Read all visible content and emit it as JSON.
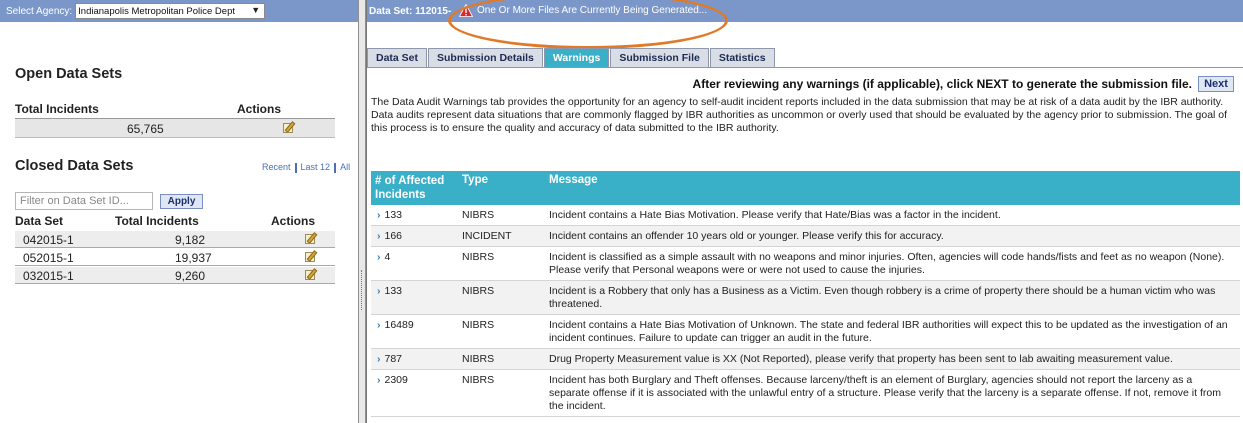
{
  "left": {
    "agency_label": "Select Agency:",
    "agency_value": "Indianapolis Metropolitan Police Dept",
    "open": {
      "title": "Open Data Sets",
      "col_total": "Total Incidents",
      "col_actions": "Actions",
      "total": "65,765"
    },
    "closed": {
      "title": "Closed Data Sets",
      "link_recent": "Recent",
      "link_last12": "Last 12",
      "link_all": "All",
      "filter_placeholder": "Filter on Data Set ID...",
      "apply_label": "Apply",
      "col_dataset": "Data Set",
      "col_total": "Total Incidents",
      "col_actions": "Actions",
      "rows": [
        {
          "dataset": "042015-1",
          "total": "9,182"
        },
        {
          "dataset": "052015-1",
          "total": "19,937"
        },
        {
          "dataset": "032015-1",
          "total": "9,260"
        }
      ]
    }
  },
  "right": {
    "dataset_label": "Data Set: 112015-",
    "generating_msg": "One Or More Files Are Currently Being Generated...",
    "tabs": [
      "Data Set",
      "Submission Details",
      "Warnings",
      "Submission File",
      "Statistics"
    ],
    "active_tab": "Warnings",
    "next_text": "After reviewing any warnings (if applicable), click NEXT to generate the submission file.",
    "next_label": "Next",
    "description": "The Data Audit Warnings tab provides the opportunity for an agency to self-audit incident reports included in the data submission that may be at risk of a data audit by the IBR authority. Data audits represent data situations that are commonly flagged by IBR authorities as uncommon or overly used that should be evaluated by the agency prior to submission. The goal of this process is to ensure the quality and accuracy of data submitted to the IBR authority.",
    "grid": {
      "col_count": "# of Affected Incidents",
      "col_type": "Type",
      "col_message": "Message",
      "rows": [
        {
          "count": "133",
          "type": "NIBRS",
          "message": "Incident contains a Hate Bias Motivation. Please verify that Hate/Bias was a factor in the incident."
        },
        {
          "count": "166",
          "type": "INCIDENT",
          "message": "Incident contains an offender 10 years old or younger. Please verify this for accuracy."
        },
        {
          "count": "4",
          "type": "NIBRS",
          "message": "Incident is classified as a simple assault with no weapons and minor injuries. Often, agencies will code hands/fists and feet as no weapon (None). Please verify that Personal weapons were or were not used to cause the injuries."
        },
        {
          "count": "133",
          "type": "NIBRS",
          "message": "Incident is a Robbery that only has a Business as a Victim.  Even though robbery is a crime of property there should be a human victim who was threatened."
        },
        {
          "count": "16489",
          "type": "NIBRS",
          "message": "Incident contains a Hate Bias Motivation of Unknown. The state and federal IBR authorities will expect this to be updated as the investigation of an incident continues. Failure to update can trigger an audit in the future."
        },
        {
          "count": "787",
          "type": "NIBRS",
          "message": "Drug Property Measurement value is XX (Not Reported), please verify that property has been sent to lab awaiting measurement value."
        },
        {
          "count": "2309",
          "type": "NIBRS",
          "message": "Incident has both Burglary and Theft offenses. Because larceny/theft is an element of Burglary, agencies should not report the larceny as a separate offense if it is associated with the unlawful entry of a structure. Please verify that the larceny is a separate offense. If not, remove it from the incident."
        }
      ]
    }
  },
  "colors": {
    "header_bar": "#7b97c9",
    "grid_header": "#3ab0c8",
    "highlight_ellipse": "#e07a2a",
    "warning_icon": "#d9262c"
  }
}
